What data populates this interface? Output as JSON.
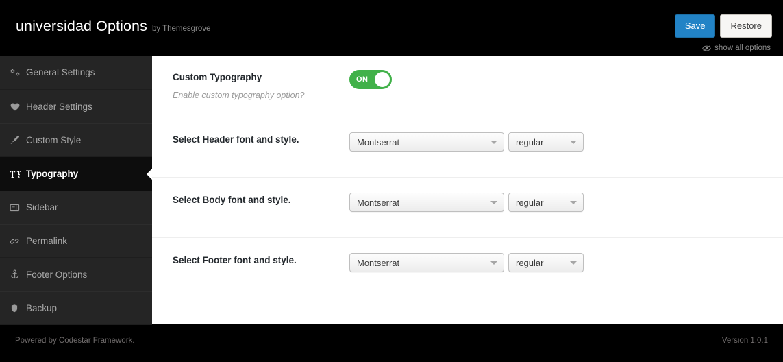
{
  "header": {
    "title": "universidad Options",
    "byline": "by Themesgrove",
    "save_label": "Save",
    "restore_label": "Restore",
    "show_all_label": "show all options",
    "accent_color": "#2283c6"
  },
  "sidebar": {
    "items": [
      {
        "label": "General Settings",
        "icon": "cogs-icon",
        "active": false
      },
      {
        "label": "Header Settings",
        "icon": "heart-icon",
        "active": false
      },
      {
        "label": "Custom Style",
        "icon": "paint-brush-icon",
        "active": false
      },
      {
        "label": "Typography",
        "icon": "text-height-icon",
        "active": true
      },
      {
        "label": "Sidebar",
        "icon": "sidebar-icon",
        "active": false
      },
      {
        "label": "Permalink",
        "icon": "link-icon",
        "active": false
      },
      {
        "label": "Footer Options",
        "icon": "anchor-icon",
        "active": false
      },
      {
        "label": "Backup",
        "icon": "shield-icon",
        "active": false
      }
    ]
  },
  "content": {
    "rows": [
      {
        "title": "Custom Typography",
        "desc": "Enable custom typography option?",
        "type": "toggle",
        "toggle_state": "ON",
        "toggle_color": "#41b149"
      },
      {
        "title": "Select Header font and style.",
        "desc": "",
        "type": "font",
        "font_value": "Montserrat",
        "style_value": "regular"
      },
      {
        "title": "Select Body font and style.",
        "desc": "",
        "type": "font",
        "font_value": "Montserrat",
        "style_value": "regular"
      },
      {
        "title": "Select Footer font and style.",
        "desc": "",
        "type": "font",
        "font_value": "Montserrat",
        "style_value": "regular"
      }
    ]
  },
  "footer": {
    "powered_by": "Powered by Codestar Framework.",
    "version": "Version 1.0.1"
  }
}
